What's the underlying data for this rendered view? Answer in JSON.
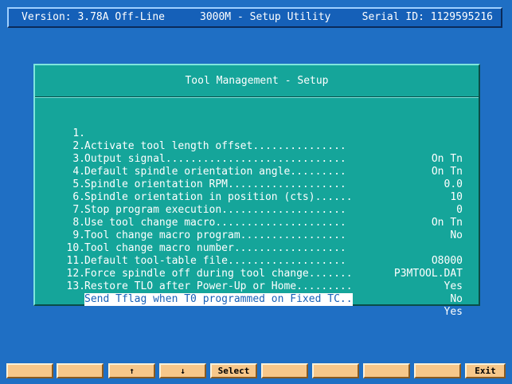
{
  "topbar": {
    "version": "Version: 3.78A Off-Line",
    "title": "3000M - Setup Utility",
    "serial": "Serial ID: 1129595216"
  },
  "dialog": {
    "title": "Tool Management - Setup",
    "selected_index": 12,
    "items": [
      {
        "num": "1.",
        "label": "Activate tool length offset...............",
        "value": "On Tn"
      },
      {
        "num": "2.",
        "label": "Output signal.............................",
        "value": "On Tn"
      },
      {
        "num": "3.",
        "label": "Default spindle orientation angle.........",
        "value": "0.0"
      },
      {
        "num": "4.",
        "label": "Spindle orientation RPM...................",
        "value": "10"
      },
      {
        "num": "5.",
        "label": "Spindle orientation in position (cts)......",
        "value": "0"
      },
      {
        "num": "6.",
        "label": "Stop program execution....................",
        "value": "On Tn"
      },
      {
        "num": "7.",
        "label": "Use tool change macro.....................",
        "value": "No"
      },
      {
        "num": "8.",
        "label": "Tool change macro program.................",
        "value": ""
      },
      {
        "num": "9.",
        "label": "Tool change macro number..................",
        "value": "O8000"
      },
      {
        "num": "10.",
        "label": "Default tool-table file...................",
        "value": "P3MTOOL.DAT"
      },
      {
        "num": "11.",
        "label": "Force spindle off during tool change.......",
        "value": "Yes"
      },
      {
        "num": "12.",
        "label": "Restore TLO after Power-Up or Home.........",
        "value": "No"
      },
      {
        "num": "13.",
        "label": "Send Tflag when T0 programmed on Fixed TC..",
        "value": "Yes"
      }
    ]
  },
  "fkeys": [
    "",
    "",
    "↑",
    "↓",
    "Select",
    "",
    "",
    "",
    "",
    "Exit"
  ]
}
